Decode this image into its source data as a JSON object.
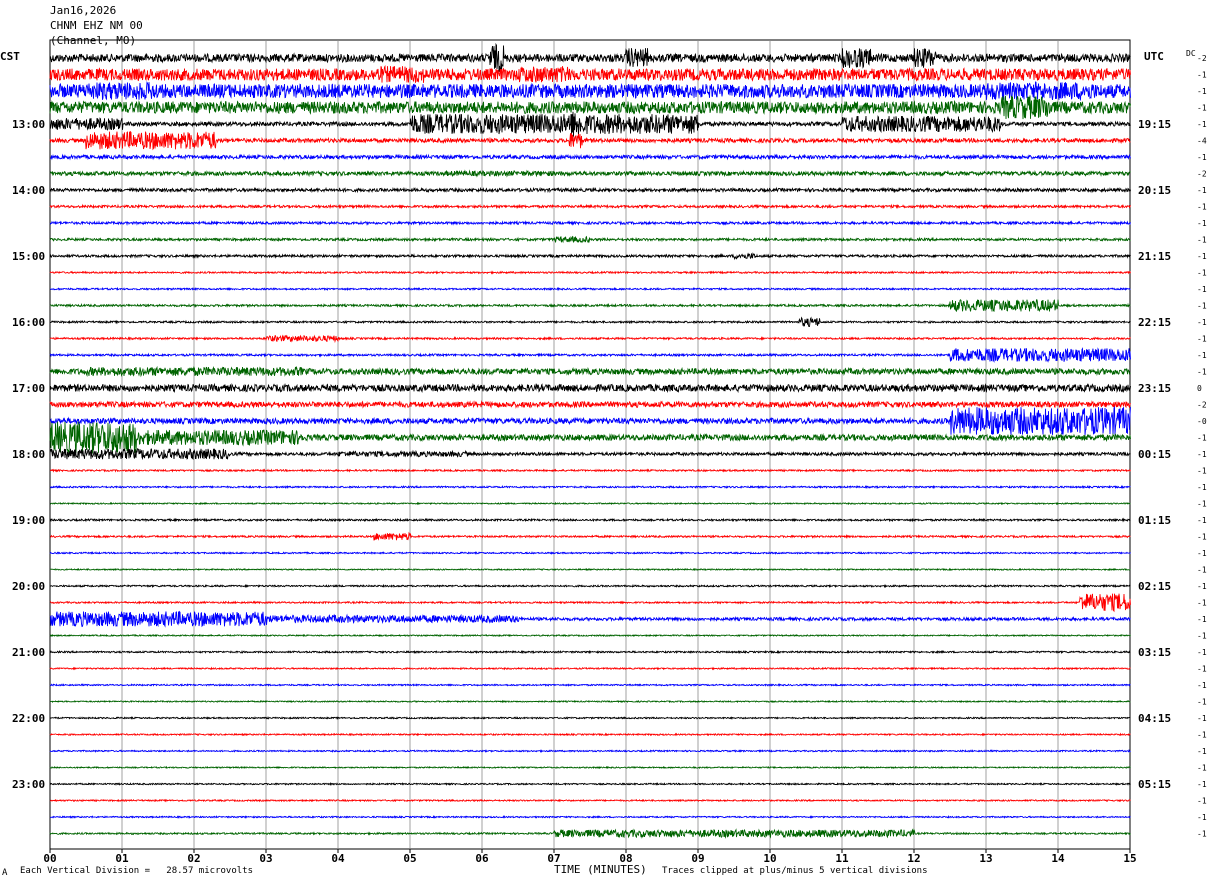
{
  "header": {
    "date": "Jan16,2026",
    "station": "CHNM EHZ NM 00",
    "units": "(Channel, MO)"
  },
  "left_label": "CST",
  "right_label": "UTC",
  "dc_label": "DC",
  "footer": {
    "scale_note": "Each Vertical Division =   28.57 microvolts",
    "xlabel": "TIME (MINUTES)",
    "clip_note": "Traces clipped at plus/minus 5 vertical divisions",
    "corner_mark": "A"
  },
  "chart_data": {
    "type": "line",
    "title": "CHNM EHZ NM 00",
    "xlabel": "TIME (MINUTES)",
    "ylabel": "",
    "xlim": [
      0,
      15
    ],
    "x_ticks": [
      "00",
      "01",
      "02",
      "03",
      "04",
      "05",
      "06",
      "07",
      "08",
      "09",
      "10",
      "11",
      "12",
      "13",
      "14",
      "15"
    ],
    "grid": true,
    "trace_colors": [
      "#000000",
      "#ff0000",
      "#0000ff",
      "#006400"
    ],
    "left_time_labels": [
      {
        "row": 4,
        "text": "13:00"
      },
      {
        "row": 8,
        "text": "14:00"
      },
      {
        "row": 12,
        "text": "15:00"
      },
      {
        "row": 16,
        "text": "16:00"
      },
      {
        "row": 20,
        "text": "17:00"
      },
      {
        "row": 24,
        "text": "18:00"
      },
      {
        "row": 28,
        "text": "19:00"
      },
      {
        "row": 32,
        "text": "20:00"
      },
      {
        "row": 36,
        "text": "21:00"
      },
      {
        "row": 40,
        "text": "22:00"
      },
      {
        "row": 44,
        "text": "23:00"
      }
    ],
    "right_time_labels": [
      {
        "row": 4,
        "text": "19:15"
      },
      {
        "row": 8,
        "text": "20:15"
      },
      {
        "row": 12,
        "text": "21:15"
      },
      {
        "row": 16,
        "text": "22:15"
      },
      {
        "row": 20,
        "text": "23:15"
      },
      {
        "row": 24,
        "text": "00:15"
      },
      {
        "row": 28,
        "text": "01:15"
      },
      {
        "row": 32,
        "text": "02:15"
      },
      {
        "row": 36,
        "text": "03:15"
      },
      {
        "row": 40,
        "text": "04:15"
      },
      {
        "row": 44,
        "text": "05:15"
      }
    ],
    "dc_offsets": [
      "-2",
      "-1",
      "-1",
      "-1",
      "-1",
      "-4",
      "-1",
      "-2",
      "-1",
      "-1",
      "-1",
      "-1",
      "-1",
      "-1",
      "-1",
      "-1",
      "-1",
      "-1",
      "-1",
      "-1",
      "0",
      "-2",
      "-0",
      "-1",
      "-1",
      "-1",
      "-1",
      "-1",
      "-1",
      "-1",
      "-1",
      "-1",
      "-1",
      "-1",
      "-1",
      "-1",
      "-1",
      "-1",
      "-1",
      "-1",
      "-1",
      "-1",
      "-1",
      "-1",
      "-1",
      "-1",
      "-1",
      "-1"
    ],
    "row_count": 48,
    "traces": [
      {
        "row": 0,
        "noise": 4,
        "events": [
          {
            "from": 0,
            "to": 15,
            "amp": 1.0
          },
          {
            "from": 6.1,
            "to": 6.3,
            "amp": 3.5
          },
          {
            "from": 8.0,
            "to": 8.3,
            "amp": 2.5
          },
          {
            "from": 11.0,
            "to": 11.4,
            "amp": 2.5
          },
          {
            "from": 12.0,
            "to": 12.3,
            "amp": 2.5
          }
        ]
      },
      {
        "row": 1,
        "noise": 6,
        "events": [
          {
            "from": 0,
            "to": 15,
            "amp": 1.0
          },
          {
            "from": 4.5,
            "to": 5.2,
            "amp": 1.4
          },
          {
            "from": 6.5,
            "to": 7.2,
            "amp": 1.4
          }
        ]
      },
      {
        "row": 2,
        "noise": 7,
        "events": [
          {
            "from": 0,
            "to": 15,
            "amp": 1.0
          },
          {
            "from": 0.5,
            "to": 1.5,
            "amp": 1.3
          },
          {
            "from": 13,
            "to": 14.5,
            "amp": 1.3
          }
        ]
      },
      {
        "row": 3,
        "noise": 6,
        "events": [
          {
            "from": 0,
            "to": 15,
            "amp": 1.0
          },
          {
            "from": 13.2,
            "to": 13.9,
            "amp": 2.0
          }
        ]
      },
      {
        "row": 4,
        "noise": 2,
        "events": [
          {
            "from": 0,
            "to": 1.0,
            "amp": 3.0
          },
          {
            "from": 5.0,
            "to": 9.0,
            "amp": 5.0
          },
          {
            "from": 11.0,
            "to": 13.2,
            "amp": 4.0
          },
          {
            "from": 7.2,
            "to": 7.4,
            "amp": 7.0
          }
        ]
      },
      {
        "row": 5,
        "noise": 2,
        "events": [
          {
            "from": 0.5,
            "to": 2.3,
            "amp": 4.5
          },
          {
            "from": 7.2,
            "to": 7.4,
            "amp": 4.0
          }
        ]
      },
      {
        "row": 6,
        "noise": 1.8,
        "events": []
      },
      {
        "row": 7,
        "noise": 2.0,
        "events": [
          {
            "from": 5.5,
            "to": 7.0,
            "amp": 1.3
          }
        ]
      },
      {
        "row": 8,
        "noise": 1.6,
        "events": []
      },
      {
        "row": 9,
        "noise": 1.2,
        "events": []
      },
      {
        "row": 10,
        "noise": 1.2,
        "events": []
      },
      {
        "row": 11,
        "noise": 1.2,
        "events": [
          {
            "from": 7.0,
            "to": 7.5,
            "amp": 2.0
          }
        ]
      },
      {
        "row": 12,
        "noise": 1.2,
        "events": [
          {
            "from": 9.5,
            "to": 9.8,
            "amp": 2.0
          }
        ]
      },
      {
        "row": 13,
        "noise": 0.8,
        "events": []
      },
      {
        "row": 14,
        "noise": 0.8,
        "events": []
      },
      {
        "row": 15,
        "noise": 1.0,
        "events": [
          {
            "from": 12.5,
            "to": 14.0,
            "amp": 4.0
          }
        ]
      },
      {
        "row": 16,
        "noise": 0.9,
        "events": [
          {
            "from": 10.4,
            "to": 10.7,
            "amp": 3.0
          }
        ]
      },
      {
        "row": 17,
        "noise": 0.9,
        "events": [
          {
            "from": 3.0,
            "to": 4.0,
            "amp": 2.0
          }
        ]
      },
      {
        "row": 18,
        "noise": 1.0,
        "events": [
          {
            "from": 12.5,
            "to": 15.0,
            "amp": 4.5
          }
        ]
      },
      {
        "row": 19,
        "noise": 3.0,
        "events": [
          {
            "from": 0.5,
            "to": 3.5,
            "amp": 1.5
          }
        ]
      },
      {
        "row": 20,
        "noise": 3.5,
        "events": []
      },
      {
        "row": 21,
        "noise": 2.8,
        "events": []
      },
      {
        "row": 22,
        "noise": 2.8,
        "events": [
          {
            "from": 12.5,
            "to": 15.0,
            "amp": 5.0
          }
        ]
      },
      {
        "row": 23,
        "noise": 3.0,
        "events": [
          {
            "from": 0.0,
            "to": 1.2,
            "amp": 6.0
          },
          {
            "from": 1.2,
            "to": 3.5,
            "amp": 2.5
          }
        ]
      },
      {
        "row": 24,
        "noise": 1.5,
        "events": [
          {
            "from": 0.0,
            "to": 2.5,
            "amp": 3.5
          },
          {
            "from": 4.0,
            "to": 5.8,
            "amp": 1.8
          }
        ]
      },
      {
        "row": 25,
        "noise": 0.8,
        "events": []
      },
      {
        "row": 26,
        "noise": 0.8,
        "events": []
      },
      {
        "row": 27,
        "noise": 0.6,
        "events": []
      },
      {
        "row": 28,
        "noise": 0.9,
        "events": []
      },
      {
        "row": 29,
        "noise": 0.9,
        "events": [
          {
            "from": 4.5,
            "to": 5.0,
            "amp": 2.5
          }
        ]
      },
      {
        "row": 30,
        "noise": 0.7,
        "events": []
      },
      {
        "row": 31,
        "noise": 0.6,
        "events": []
      },
      {
        "row": 32,
        "noise": 0.8,
        "events": []
      },
      {
        "row": 33,
        "noise": 0.8,
        "events": [
          {
            "from": 14.3,
            "to": 15.0,
            "amp": 6.0
          }
        ]
      },
      {
        "row": 34,
        "noise": 1.5,
        "events": [
          {
            "from": 0.0,
            "to": 3.0,
            "amp": 5.0
          },
          {
            "from": 3.0,
            "to": 6.5,
            "amp": 2.5
          }
        ]
      },
      {
        "row": 35,
        "noise": 0.6,
        "events": []
      },
      {
        "row": 36,
        "noise": 0.8,
        "events": []
      },
      {
        "row": 37,
        "noise": 0.7,
        "events": []
      },
      {
        "row": 38,
        "noise": 0.7,
        "events": []
      },
      {
        "row": 39,
        "noise": 0.6,
        "events": []
      },
      {
        "row": 40,
        "noise": 0.7,
        "events": []
      },
      {
        "row": 41,
        "noise": 0.7,
        "events": []
      },
      {
        "row": 42,
        "noise": 0.7,
        "events": []
      },
      {
        "row": 43,
        "noise": 0.6,
        "events": []
      },
      {
        "row": 44,
        "noise": 0.7,
        "events": []
      },
      {
        "row": 45,
        "noise": 0.7,
        "events": []
      },
      {
        "row": 46,
        "noise": 0.7,
        "events": []
      },
      {
        "row": 47,
        "noise": 0.8,
        "events": [
          {
            "from": 7.0,
            "to": 12.0,
            "amp": 2.5
          }
        ]
      }
    ]
  }
}
